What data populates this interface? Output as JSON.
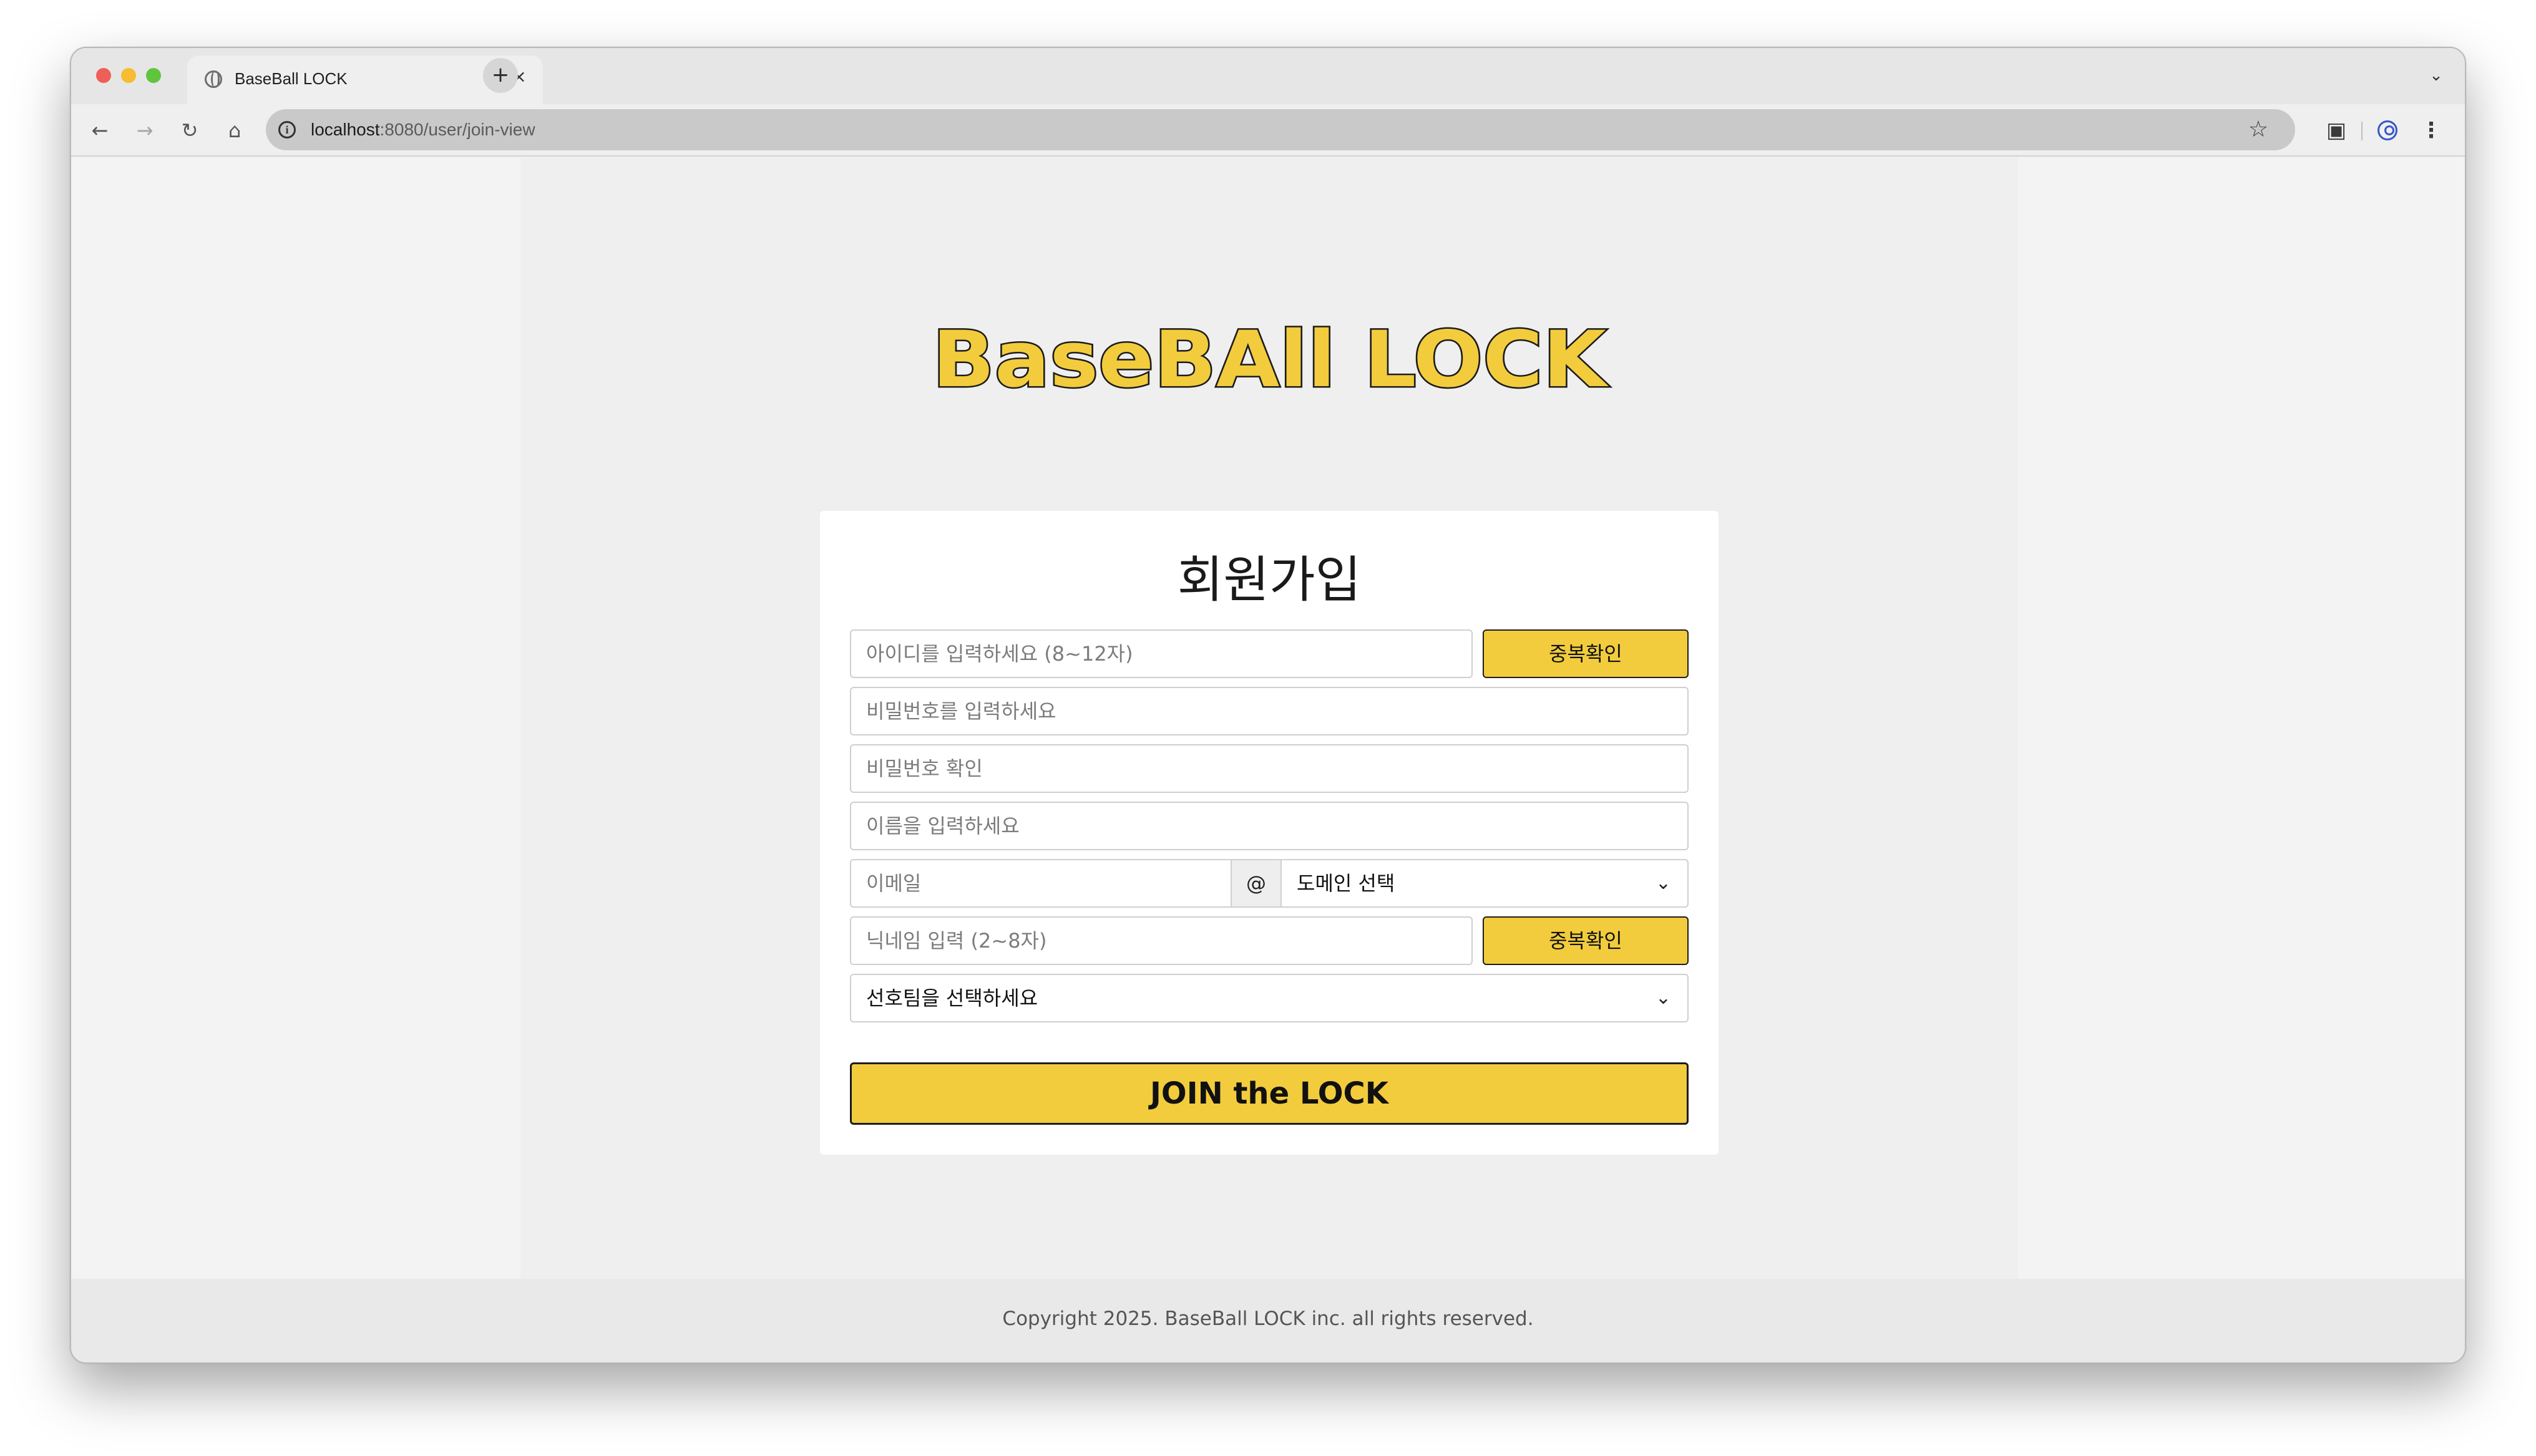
{
  "browser": {
    "tab_title": "BaseBall LOCK",
    "new_tab_symbol": "+",
    "tab_close_symbol": "×",
    "url_host": "localhost",
    "url_path": ":8080/user/join-view"
  },
  "page": {
    "logo_text": "BaseBAll LOCK",
    "title": "회원가입",
    "form": {
      "id_placeholder": "아이디를 입력하세요 (8~12자)",
      "id_check_label": "중복확인",
      "password_placeholder": "비밀번호를 입력하세요",
      "password_confirm_placeholder": "비밀번호 확인",
      "name_placeholder": "이름을 입력하세요",
      "email_placeholder": "이메일",
      "at_symbol": "@",
      "domain_selected": "도메인 선택",
      "nickname_placeholder": "닉네임 입력 (2~8자)",
      "nickname_check_label": "중복확인",
      "team_selected": "선호팀을 선택하세요",
      "submit_label": "JOIN the LOCK"
    },
    "footer_text": "Copyright 2025. BaseBall LOCK inc. all rights reserved."
  },
  "colors": {
    "accent": "#f2cc3d",
    "logo_fill": "#f2cc3d",
    "logo_outline": "#1c1c1c"
  },
  "icons": {
    "back": "arrow-left-icon",
    "forward": "arrow-right-icon",
    "reload": "reload-icon",
    "home": "home-icon",
    "site_info": "info-icon",
    "bookmark": "star-icon",
    "extensions": "puzzle-icon",
    "profile": "profile-icon",
    "menu": "kebab-menu-icon",
    "dropdown": "chevron-down-icon"
  }
}
